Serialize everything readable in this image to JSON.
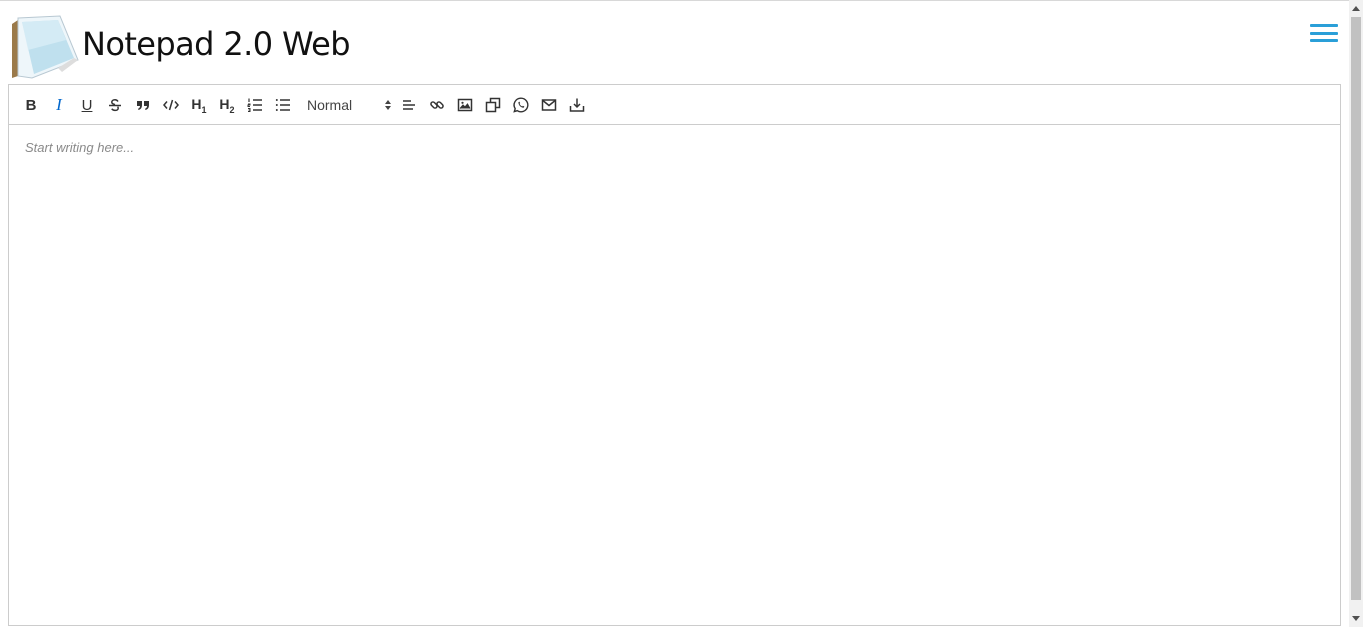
{
  "app": {
    "title": "Notepad 2.0 Web"
  },
  "toolbar": {
    "bold_label": "B",
    "italic_label": "I",
    "underline_label": "U",
    "h1_label": "H",
    "h1_sub": "1",
    "h2_label": "H",
    "h2_sub": "2",
    "format_select_value": "Normal"
  },
  "editor": {
    "placeholder": "Start writing here..."
  },
  "colors": {
    "accent": "#2a9fd8",
    "active": "#0066cc",
    "placeholder": "#8a8a8a"
  }
}
